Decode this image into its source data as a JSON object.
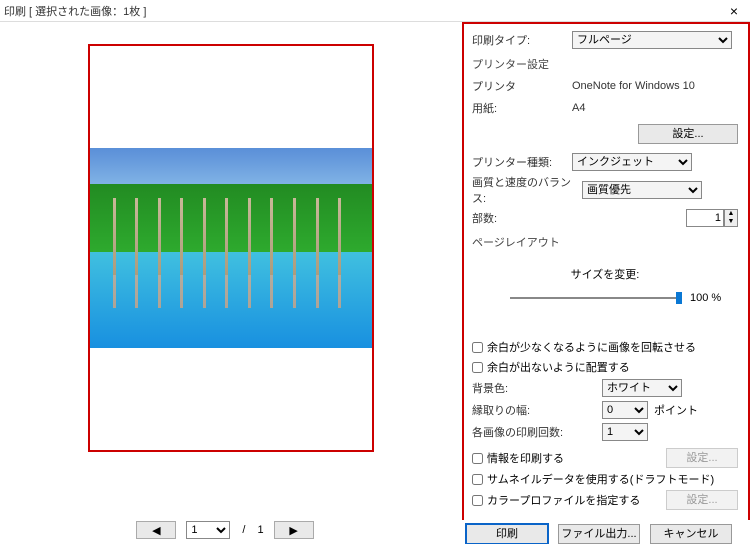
{
  "window": {
    "title": "印刷 [ 選択された画像：1枚 ]"
  },
  "panel": {
    "printTypeLabel": "印刷タイプ:",
    "printTypeValue": "フルページ",
    "printerSettingsHeader": "プリンター設定",
    "printerLabel": "プリンタ",
    "printerValue": "OneNote for Windows 10",
    "paperLabel": "用紙:",
    "paperValue": "A4",
    "settingsBtn": "設定...",
    "printerKindLabel": "プリンター種類:",
    "printerKindValue": "インクジェット",
    "qualityLabel": "画質と速度のバランス:",
    "qualityValue": "画質優先",
    "copiesLabel": "部数:",
    "copiesValue": "1",
    "pageLayoutHeader": "ページレイアウト",
    "resizeLabel": "サイズを変更:",
    "sliderValue": "100 %",
    "rotateCheckbox": "余白が少なくなるように画像を回転させる",
    "fitCheckbox": "余白が出ないように配置する",
    "bgColorLabel": "背景色:",
    "bgColorValue": "ホワイト",
    "borderWidthLabel": "縁取りの幅:",
    "borderWidthValue": "0",
    "borderWidthUnit": "ポイント",
    "copiesPerImageLabel": "各画像の印刷回数:",
    "copiesPerImageValue": "1",
    "printInfoCheckbox": "情報を印刷する",
    "thumbnailCheckbox": "サムネイルデータを使用する(ドラフトモード)",
    "colorProfileCheckbox": "カラープロファイルを指定する",
    "settingsBtnDisabled": "設定..."
  },
  "pager": {
    "current": "1",
    "total": "1"
  },
  "footer": {
    "print": "印刷",
    "fileOutput": "ファイル出力...",
    "cancel": "キャンセル"
  }
}
